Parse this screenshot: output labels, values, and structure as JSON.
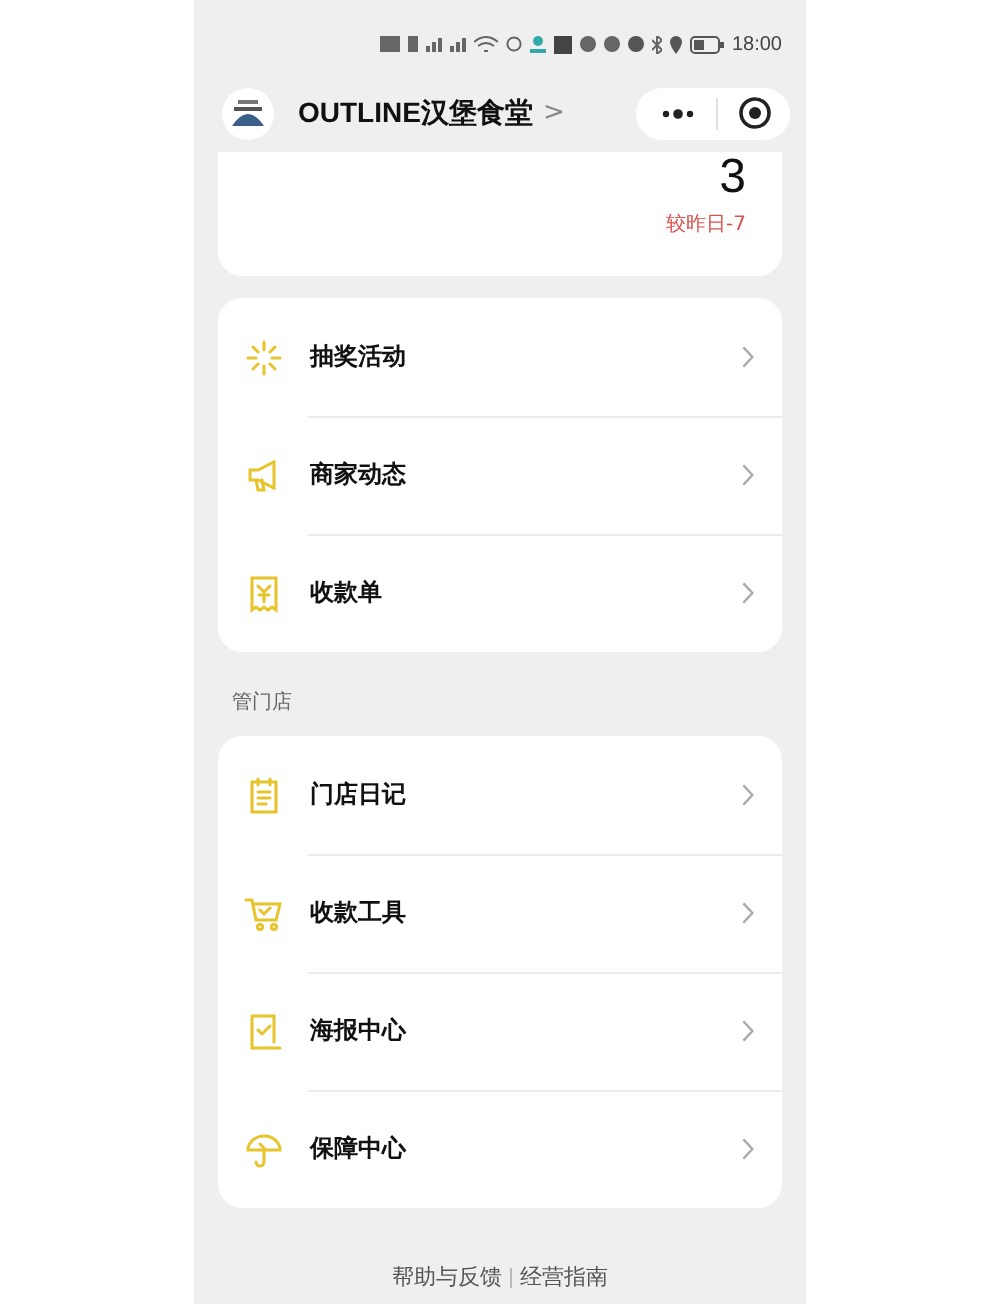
{
  "status_bar": {
    "time": "18:00"
  },
  "nav": {
    "title": "OUTLINE汉堡食堂",
    "chevron": ">"
  },
  "stat_card": {
    "value": "3",
    "change": "较昨日-7"
  },
  "menu_groups": [
    {
      "items": [
        {
          "label": "抽奖活动",
          "kind": "lottery"
        },
        {
          "label": "商家动态",
          "kind": "news"
        },
        {
          "label": "收款单",
          "kind": "receipt"
        }
      ]
    },
    {
      "title": "管门店",
      "items": [
        {
          "label": "门店日记",
          "kind": "diary"
        },
        {
          "label": "收款工具",
          "kind": "cart"
        },
        {
          "label": "海报中心",
          "kind": "poster"
        },
        {
          "label": "保障中心",
          "kind": "umbrella"
        }
      ]
    }
  ],
  "footer_links": [
    "帮助与反馈",
    "经营指南"
  ]
}
